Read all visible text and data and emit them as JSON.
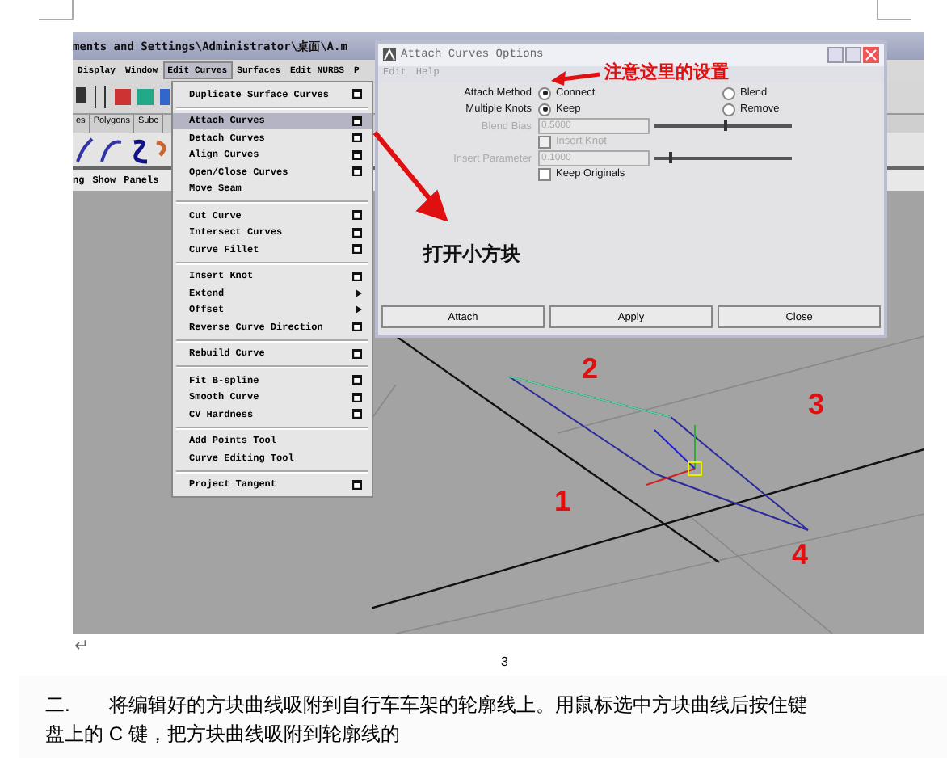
{
  "window": {
    "title": "ments and Settings\\Administrator\\桌面\\A.m"
  },
  "menubar": [
    {
      "label": "Display",
      "selected": false
    },
    {
      "label": "Window",
      "selected": false
    },
    {
      "label": "Edit Curves",
      "selected": true
    },
    {
      "label": "Surfaces",
      "selected": false
    },
    {
      "label": "Edit NURBS",
      "selected": false
    },
    {
      "label": "P",
      "selected": false
    }
  ],
  "shelf_tabs": [
    {
      "label": "es",
      "selected": false
    },
    {
      "label": "Polygons",
      "selected": false
    },
    {
      "label": "Subc",
      "selected": false
    }
  ],
  "panel_menu": [
    "ng",
    "Show",
    "Panels"
  ],
  "dropdown": {
    "groups": [
      [
        {
          "label": "Duplicate Surface Curves",
          "kind": "option",
          "selected": false
        }
      ],
      [
        {
          "label": "Attach Curves",
          "kind": "option",
          "selected": true
        },
        {
          "label": "Detach Curves",
          "kind": "option",
          "selected": false
        },
        {
          "label": "Align Curves",
          "kind": "option",
          "selected": false
        },
        {
          "label": "Open/Close Curves",
          "kind": "option",
          "selected": false
        },
        {
          "label": "Move Seam",
          "kind": "plain",
          "selected": false
        }
      ],
      [
        {
          "label": "Cut Curve",
          "kind": "option",
          "selected": false
        },
        {
          "label": "Intersect Curves",
          "kind": "option",
          "selected": false
        },
        {
          "label": "Curve Fillet",
          "kind": "option",
          "selected": false
        }
      ],
      [
        {
          "label": "Insert Knot",
          "kind": "option",
          "selected": false
        },
        {
          "label": "Extend",
          "kind": "submenu",
          "selected": false
        },
        {
          "label": "Offset",
          "kind": "submenu",
          "selected": false
        },
        {
          "label": "Reverse Curve Direction",
          "kind": "option",
          "selected": false
        }
      ],
      [
        {
          "label": "Rebuild Curve",
          "kind": "option",
          "selected": false
        }
      ],
      [
        {
          "label": "Fit B-spline",
          "kind": "option",
          "selected": false
        },
        {
          "label": "Smooth Curve",
          "kind": "option",
          "selected": false
        },
        {
          "label": "CV Hardness",
          "kind": "option",
          "selected": false
        }
      ],
      [
        {
          "label": "Add Points Tool",
          "kind": "plain",
          "selected": false
        },
        {
          "label": "Curve Editing Tool",
          "kind": "plain",
          "selected": false
        }
      ],
      [
        {
          "label": "Project Tangent",
          "kind": "option",
          "selected": false
        }
      ]
    ]
  },
  "dialog": {
    "title": "Attach Curves Options",
    "menu": [
      "Edit",
      "Help"
    ],
    "radio_rows": [
      {
        "label": "Attach Method",
        "options": [
          {
            "label": "Connect",
            "selected": true
          },
          {
            "label": "Blend",
            "selected": false
          }
        ]
      },
      {
        "label": "Multiple Knots",
        "options": [
          {
            "label": "Keep",
            "selected": true
          },
          {
            "label": "Remove",
            "selected": false
          }
        ]
      }
    ],
    "blend_bias": {
      "label": "Blend Bias",
      "value": "0.5000",
      "level": 0.5,
      "disabled": true
    },
    "insert_knot": {
      "label": "Insert Knot",
      "checked": false,
      "disabled": true
    },
    "insert_parameter": {
      "label": "Insert Parameter",
      "value": "0.1000",
      "level": 0.1,
      "disabled": true
    },
    "keep_originals": {
      "label": "Keep Originals",
      "checked": false,
      "disabled": false
    },
    "buttons": [
      "Attach",
      "Apply",
      "Close"
    ]
  },
  "annotations": {
    "settings_note": "注意这里的设置",
    "open_box_note": "打开小方块",
    "numbers": [
      "1",
      "2",
      "3",
      "4"
    ]
  },
  "return_mark": "↵",
  "figure_label": "3",
  "caption": [
    "二.",
    "将编辑好的方块曲线吸附到自行车车架的轮廓线上。用鼠标选中方块曲线后按住键",
    "盘上的 C 键，把方块曲线吸附到轮廓线的"
  ]
}
